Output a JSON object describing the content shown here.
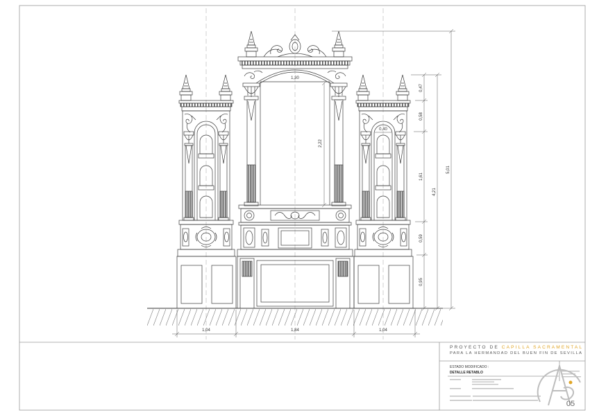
{
  "sheet": {
    "project_prefix": "PROYECTO DE",
    "project_highlight": "CAPILLA SACRAMENTAL",
    "project_subtitle": "PARA LA HERMANDAD DEL BUEN FIN DE SEVILLA",
    "state_label": "ESTADO MODIFICADO :",
    "drawing_title": "DETALLE RETABLO",
    "sheet_number": "05"
  },
  "dimensions": {
    "bottom": {
      "left": "1,04",
      "center": "1,84",
      "right": "1,04"
    },
    "right_chain": {
      "a": "0,47",
      "b": "0,58",
      "c": "1,61",
      "d": "0,59",
      "e": "0,95"
    },
    "right_subtotal": "4,21",
    "right_total": "5,01",
    "opening_width": "1,30",
    "opening_height": "2,22",
    "niche_width": "0,40"
  },
  "colors": {
    "highlight": "#e0a526",
    "line": "#3a3a3a"
  }
}
